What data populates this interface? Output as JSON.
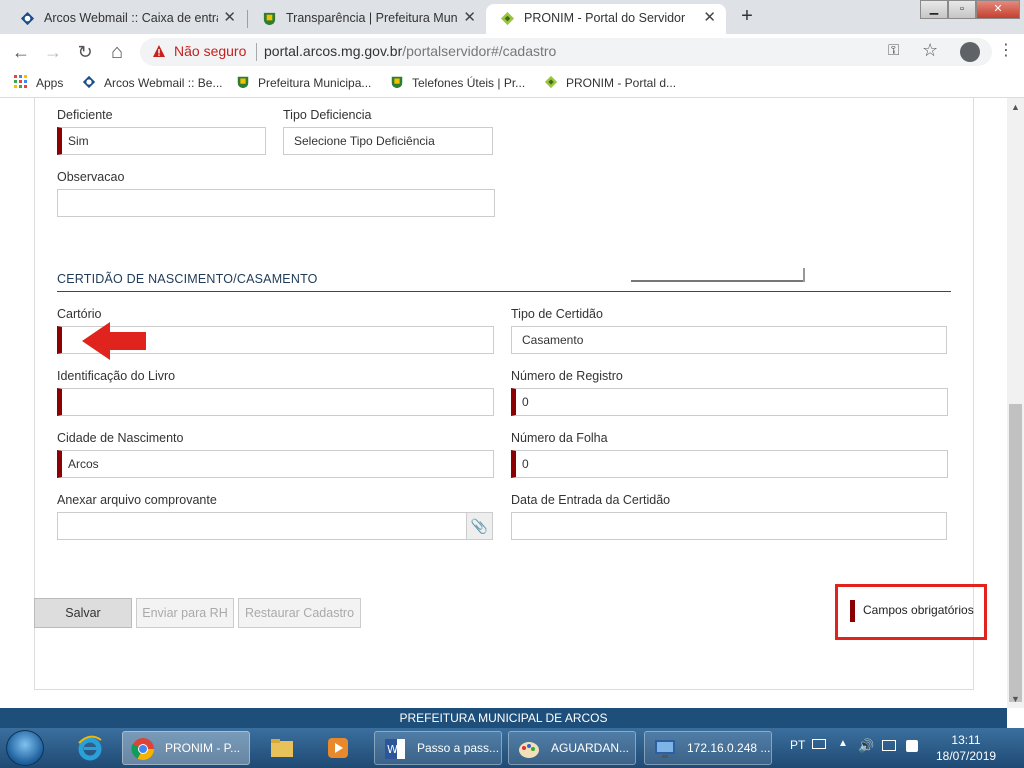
{
  "browser": {
    "tabs": [
      {
        "title": "Arcos Webmail :: Caixa de entrad",
        "icon": "webmail-icon"
      },
      {
        "title": "Transparência | Prefeitura Munic",
        "icon": "prefeitura-crest-icon"
      },
      {
        "title": "PRONIM - Portal do Servidor",
        "icon": "pronim-icon"
      }
    ],
    "close_glyph": "✕",
    "new_tab_glyph": "+",
    "window_controls": {
      "minimize": "▁",
      "maximize": "▫",
      "close": "✕"
    },
    "nav": {
      "back": "←",
      "forward": "→",
      "reload": "↻",
      "home": "⌂"
    },
    "security_label": "Não seguro",
    "url_host": "portal.arcos.mg.gov.br",
    "url_path": "/portalservidor#/cadastro",
    "key_icon": "⚿",
    "star_icon": "☆",
    "menu_icon": "⋮",
    "bookmarks": [
      {
        "label": "Apps",
        "icon": "apps-grid-icon"
      },
      {
        "label": "Arcos Webmail :: Be...",
        "icon": "webmail-icon"
      },
      {
        "label": "Prefeitura Municipa...",
        "icon": "prefeitura-crest-icon"
      },
      {
        "label": "Telefones Úteis | Pr...",
        "icon": "prefeitura-crest-icon"
      },
      {
        "label": "PRONIM - Portal d...",
        "icon": "pronim-icon"
      }
    ]
  },
  "form": {
    "deficiente": {
      "label": "Deficiente",
      "value": "Sim"
    },
    "tipo_deficiencia": {
      "label": "Tipo Deficiencia",
      "value": "Selecione Tipo Deficiência"
    },
    "observacao": {
      "label": "Observacao",
      "value": ""
    },
    "section_title": "CERTIDÃO DE NASCIMENTO/CASAMENTO",
    "cartorio": {
      "label": "Cartório",
      "value": ""
    },
    "tipo_certidao": {
      "label": "Tipo de Certidão",
      "value": "Casamento"
    },
    "identificacao_livro": {
      "label": "Identificação do Livro",
      "value": ""
    },
    "numero_registro": {
      "label": "Número de Registro",
      "value": "0"
    },
    "cidade_nascimento": {
      "label": "Cidade de Nascimento",
      "value": "Arcos"
    },
    "numero_folha": {
      "label": "Número da Folha",
      "value": "0"
    },
    "anexar_arquivo": {
      "label": "Anexar arquivo comprovante",
      "value": "",
      "clip_icon": "📎"
    },
    "data_entrada": {
      "label": "Data de Entrada da Certidão",
      "value": ""
    }
  },
  "actions": {
    "save": "Salvar",
    "send_rh": "Enviar para RH",
    "restore": "Restaurar Cadastro"
  },
  "legend": {
    "required_fields": "Campos obrigatórios"
  },
  "footer": {
    "text": "PREFEITURA MUNICIPAL DE ARCOS"
  },
  "scrollbar": {
    "up": "▲",
    "down": "▼"
  },
  "taskbar": {
    "windows": [
      {
        "label": "PRONIM - P...",
        "icon": "chrome-icon",
        "active": true
      },
      {
        "label": "",
        "icon": "explorer-folder-icon",
        "active": false
      },
      {
        "label": "",
        "icon": "media-player-icon",
        "active": false
      },
      {
        "label": "Passo a pass...",
        "icon": "word-icon",
        "active": false
      },
      {
        "label": "AGUARDAN...",
        "icon": "paint-icon",
        "active": false
      },
      {
        "label": "172.16.0.248 ...",
        "icon": "remote-desktop-icon",
        "active": false
      }
    ],
    "language": "PT",
    "time": "13:11",
    "date": "18/07/2019"
  },
  "colors": {
    "required_marker": "#8b0000",
    "annotation_red": "#e0241d",
    "footer_blue": "#1e4f7a",
    "section_blue": "#1f3b57"
  }
}
